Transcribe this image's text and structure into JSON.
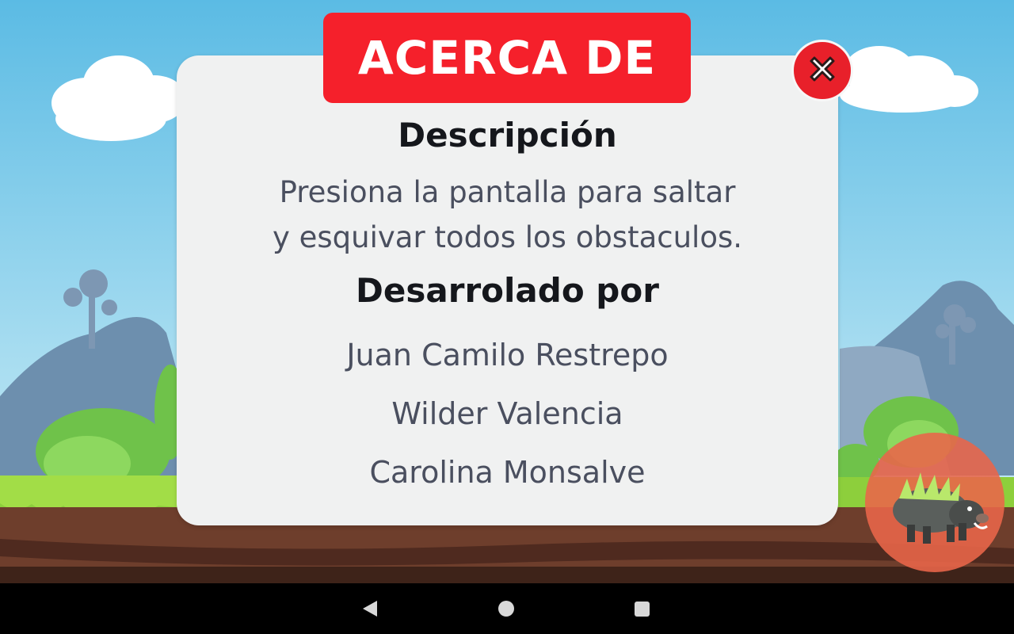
{
  "dialog": {
    "title": "ACERCA DE",
    "description_heading": "Descripción",
    "description_lines": [
      "Presiona la pantalla para saltar",
      "y esquivar todos los obstaculos."
    ],
    "developers_heading": "Desarrolado por",
    "developers": [
      "Juan Camilo Restrepo",
      "Wilder Valencia",
      "Carolina Monsalve"
    ],
    "close_icon": "close-icon"
  },
  "colors": {
    "banner_red": "#f5202b",
    "close_red": "#e8202a",
    "panel": "#f0f1f1",
    "sky_top": "#5bbbe4",
    "grass": "#8dcf3c"
  },
  "system_nav": {
    "back_icon": "back-icon",
    "home_icon": "home-icon",
    "recents_icon": "recents-icon"
  }
}
